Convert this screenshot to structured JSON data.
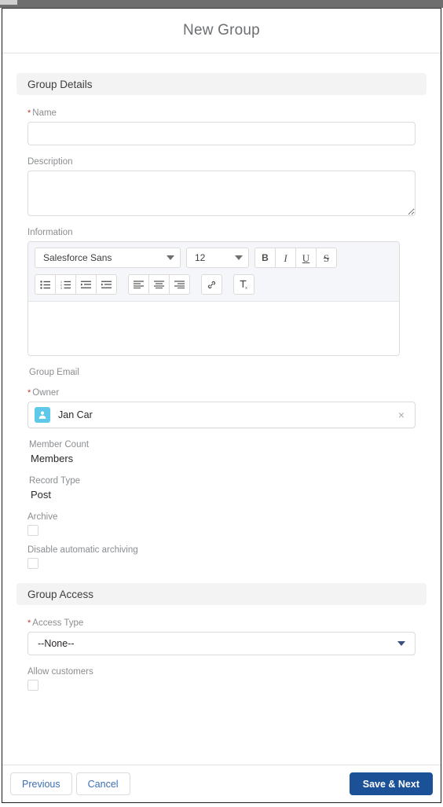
{
  "window": {
    "title": "New Group"
  },
  "sections": {
    "group_details": {
      "title": "Group Details",
      "name": {
        "label": "Name",
        "required": true,
        "value": "",
        "placeholder": ""
      },
      "description": {
        "label": "Description",
        "value": "",
        "placeholder": ""
      },
      "information": {
        "label": "Information",
        "value": "",
        "toolbar": {
          "font_family": "Salesforce Sans",
          "font_size": "12",
          "buttons": [
            {
              "name": "bold-button",
              "glyph": "B"
            },
            {
              "name": "italic-button",
              "glyph": "I"
            },
            {
              "name": "underline-button",
              "glyph": "U"
            },
            {
              "name": "strikethrough-button",
              "glyph": "S"
            }
          ],
          "buttons_row2": [
            "bulleted-list-icon",
            "numbered-list-icon",
            "indent-decrease-icon",
            "indent-increase-icon",
            "align-left-icon",
            "align-center-icon",
            "align-right-icon",
            "link-icon",
            "remove-format-icon"
          ]
        }
      },
      "group_email": {
        "label": "Group Email",
        "value": ""
      },
      "owner": {
        "label": "Owner",
        "required": true,
        "value": "Jan Car",
        "avatar_icon": "user-avatar-icon",
        "clear_icon": "×"
      },
      "member_count": {
        "label": "Member Count",
        "value": "Members"
      },
      "record_type": {
        "label": "Record Type",
        "value": "Post"
      },
      "archive": {
        "label": "Archive",
        "checked": false
      },
      "disable_automatic_archiving": {
        "label": "Disable automatic archiving",
        "checked": false
      }
    },
    "group_access": {
      "title": "Group Access",
      "access_type": {
        "label": "Access Type",
        "required": true,
        "value": "--None--"
      },
      "allow_customers": {
        "label": "Allow customers",
        "checked": false
      }
    }
  },
  "footer": {
    "previous_label": "Previous",
    "cancel_label": "Cancel",
    "save_next_label": "Save & Next"
  },
  "colors": {
    "brand_blue": "#1b5297",
    "link_blue": "#3b6fb5",
    "required_red": "#c23934",
    "avatar_blue": "#5ec8ea",
    "section_bg": "#f3f3f3",
    "label_gray": "#8a8d90",
    "border_gray": "#dddbda"
  }
}
